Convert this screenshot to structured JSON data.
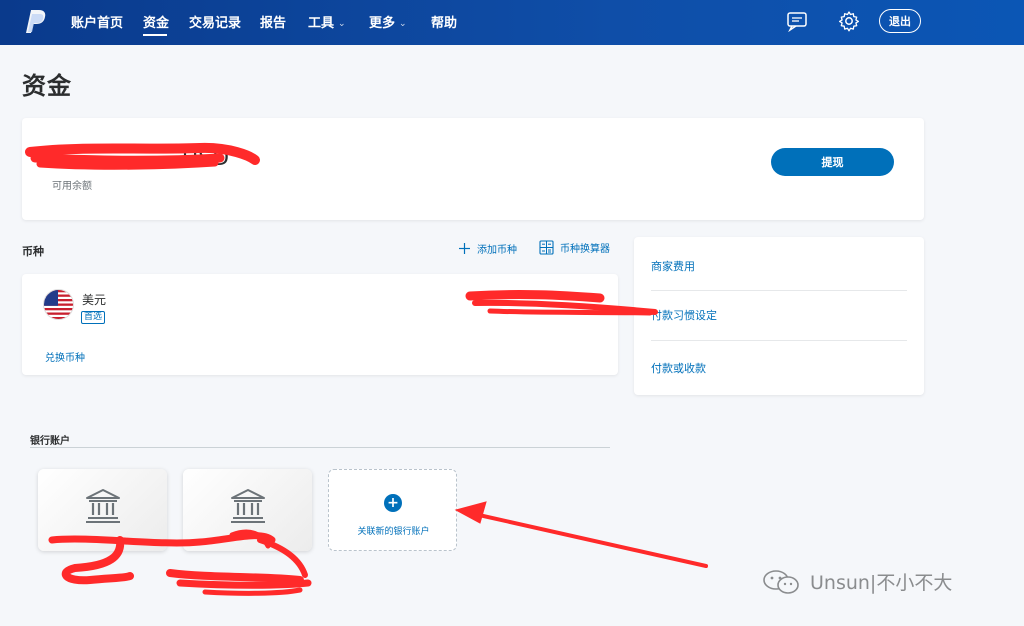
{
  "nav": {
    "items": [
      {
        "label": "账户首页",
        "has_dropdown": false
      },
      {
        "label": "资金",
        "has_dropdown": false,
        "active": true
      },
      {
        "label": "交易记录",
        "has_dropdown": false
      },
      {
        "label": "报告",
        "has_dropdown": false
      },
      {
        "label": "工具",
        "has_dropdown": true
      },
      {
        "label": "更多",
        "has_dropdown": true
      },
      {
        "label": "帮助",
        "has_dropdown": false
      }
    ],
    "logout_label": "退出",
    "icons": [
      "paypal-logo",
      "message-center-icon",
      "settings-gear-icon"
    ]
  },
  "page": {
    "title": "资金"
  },
  "balance": {
    "amount_visible": "USD",
    "label": "可用余额",
    "withdraw_label": "提现"
  },
  "currencies": {
    "section_title": "币种",
    "add_currency_label": "添加币种",
    "calculator_label": "币种换算器",
    "items": [
      {
        "name": "美元",
        "badge": "首选",
        "flag": "us-flag"
      }
    ],
    "convert_label": "兑换币种"
  },
  "side_links": [
    {
      "label": "商家费用"
    },
    {
      "label": "付款习惯设定"
    },
    {
      "label": "付款或收款"
    }
  ],
  "bank": {
    "section_title": "银行账户",
    "link_new_label": "关联新的银行账户",
    "tiles": [
      {
        "icon": "bank-icon"
      },
      {
        "icon": "bank-icon"
      }
    ]
  },
  "watermark": {
    "text": "Unsun|不小不大"
  },
  "colors": {
    "brand_blue": "#0070ba",
    "nav_blue": "#0f4ea8",
    "redaction_red": "#ff2a2a"
  }
}
